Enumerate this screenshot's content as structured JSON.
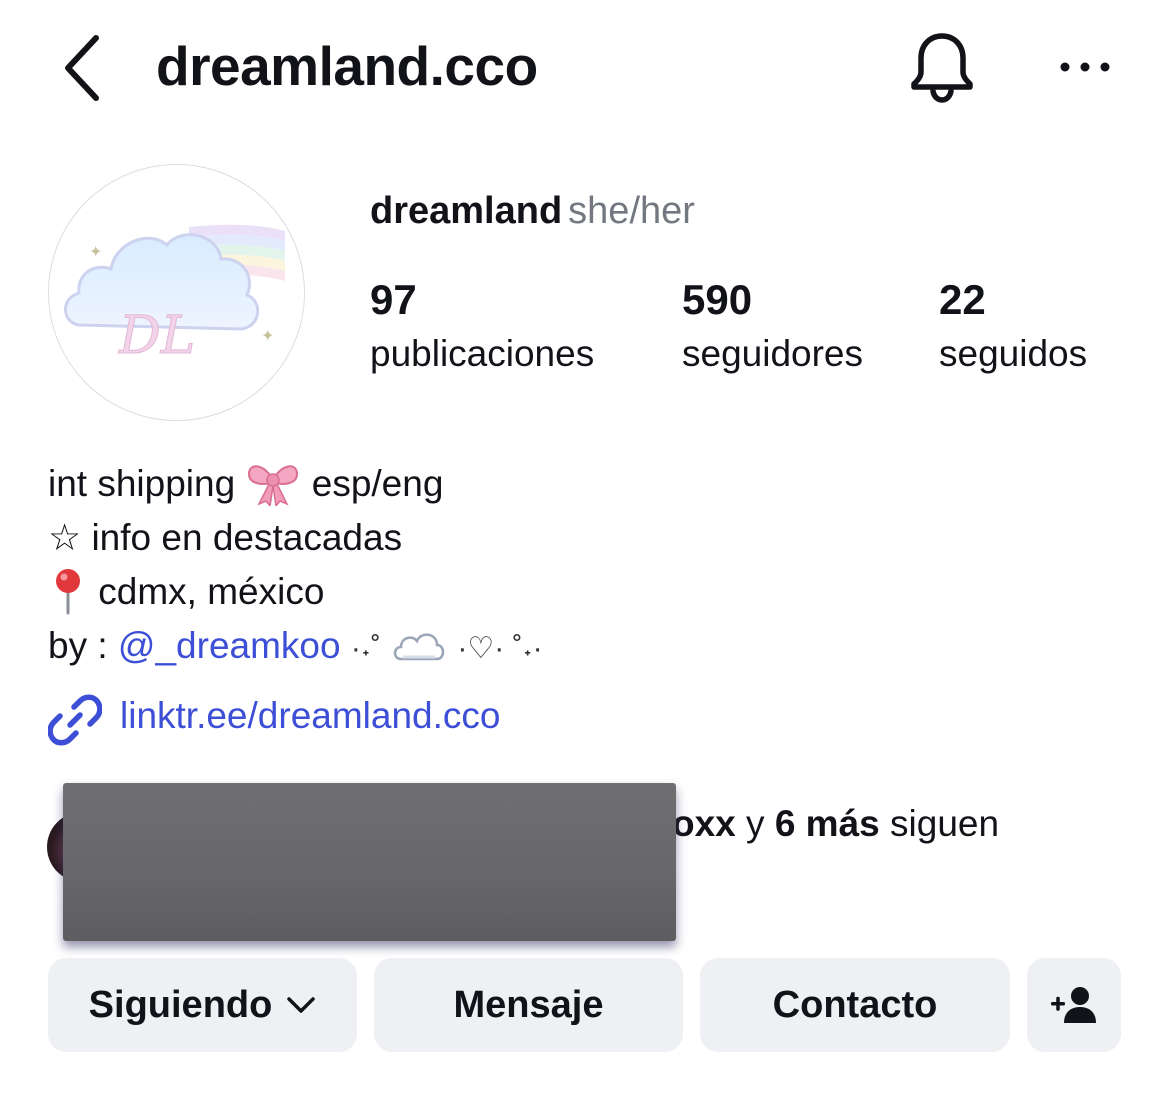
{
  "header": {
    "username": "dreamland.cco",
    "back_icon": "chevron-left-icon",
    "notification_icon": "bell-icon",
    "more_icon": "more-horizontal-icon"
  },
  "profile": {
    "avatar_monogram": "DL",
    "display_name": "dreamland",
    "pronouns": "she/her",
    "stats": {
      "posts": {
        "value": "97",
        "label": "publicaciones"
      },
      "followers": {
        "value": "590",
        "label": "seguidores"
      },
      "following": {
        "value": "22",
        "label": "seguidos"
      }
    }
  },
  "bio": {
    "line1_a": "int shipping",
    "line1_b": "esp/eng",
    "line2": "☆ info en destacadas",
    "line3": "cdmx, méxico",
    "line4_prefix": "by :",
    "line4_mention": "@_dreamkoo",
    "line4_deco_a": "·˖˚",
    "line4_deco_b": "·♡·  ˚˖·",
    "link": "linktr.ee/dreamland.cco"
  },
  "followed_by": {
    "visible_fragment": "oxx",
    "joiner": "y",
    "count": "6 más",
    "suffix": "siguen"
  },
  "actions": {
    "following_label": "Siguiendo",
    "message_label": "Mensaje",
    "contact_label": "Contacto",
    "suggest_icon": "add-person-icon"
  },
  "colors": {
    "link_blue": "#3d4fd6",
    "button_bg": "#eef0f4",
    "muted_text": "#737780"
  }
}
